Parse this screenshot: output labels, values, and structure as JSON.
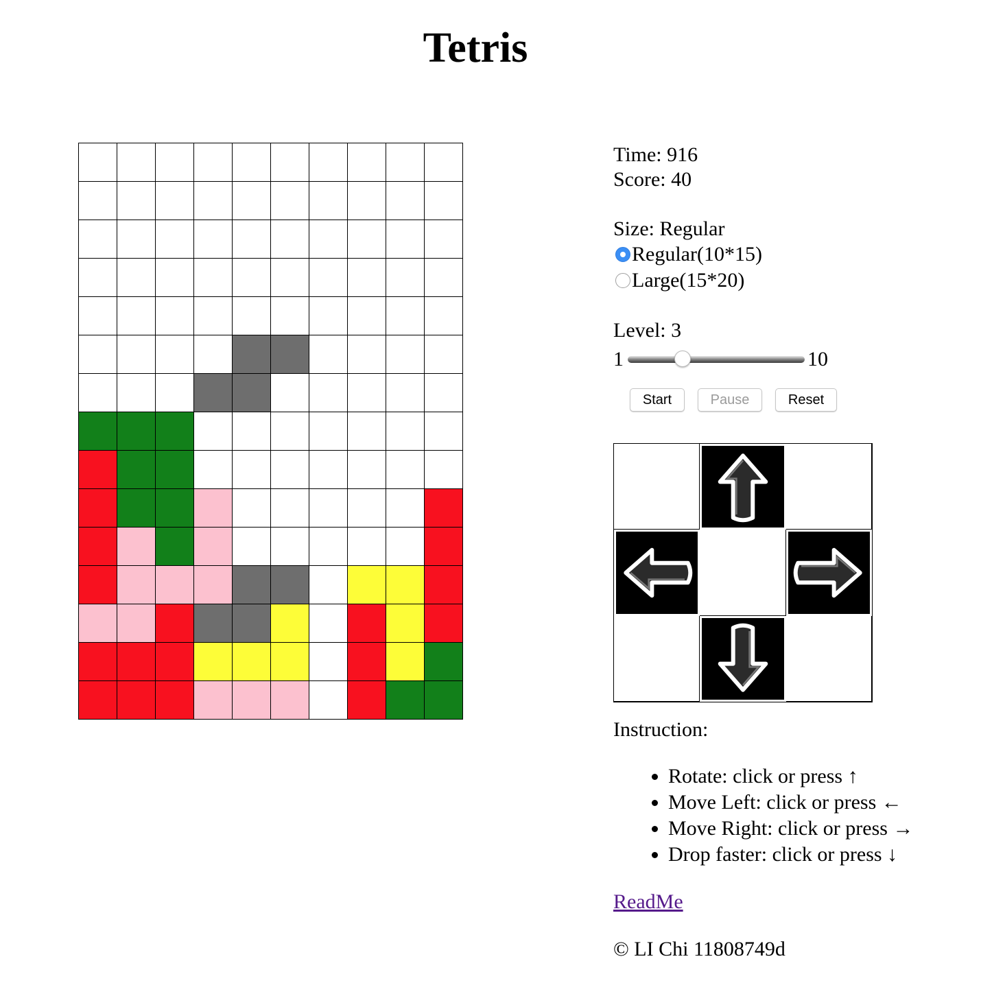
{
  "title": "Tetris",
  "stats": {
    "time_label": "Time: 916",
    "score_label": "Score: 40"
  },
  "size": {
    "label": "Size: Regular",
    "options": [
      {
        "label": "Regular(10*15)",
        "checked": true
      },
      {
        "label": "Large(15*20)",
        "checked": false
      }
    ]
  },
  "level": {
    "label": "Level: 3",
    "value": 3,
    "min_label": "1",
    "max_label": "10",
    "min": 1,
    "max": 10
  },
  "buttons": {
    "start": "Start",
    "pause": "Pause",
    "reset": "Reset"
  },
  "controls": {
    "up_icon": "arrow-up-icon",
    "left_icon": "arrow-left-icon",
    "right_icon": "arrow-right-icon",
    "down_icon": "arrow-down-icon"
  },
  "instructions": {
    "heading": "Instruction:",
    "items": [
      "Rotate: click or press ↑",
      "Move Left: click or press ←",
      "Move Right: click or press →",
      "Drop faster: click or press ↓"
    ]
  },
  "readme": "ReadMe",
  "footer": "© LI Chi 11808749d",
  "colors": {
    "X": "#12801a",
    "R": "#f8111f",
    "P": "#fcc1cf",
    "Y": "#fdfd38",
    "D": "#6e6e6e",
    ".": "#ffffff"
  },
  "board": {
    "cols": 10,
    "rows": 15,
    "grid": [
      "..........",
      "..........",
      "..........",
      "..........",
      "..........",
      "....DD....",
      "...DD.....",
      "XXX.......",
      "RXX.......",
      "RXXP.....R",
      "RPXP.....R",
      "RPPPDD.YYR",
      "PPRDDY.RYR",
      "RRRYYY.RYX",
      "RRRPPP.RXX"
    ]
  }
}
